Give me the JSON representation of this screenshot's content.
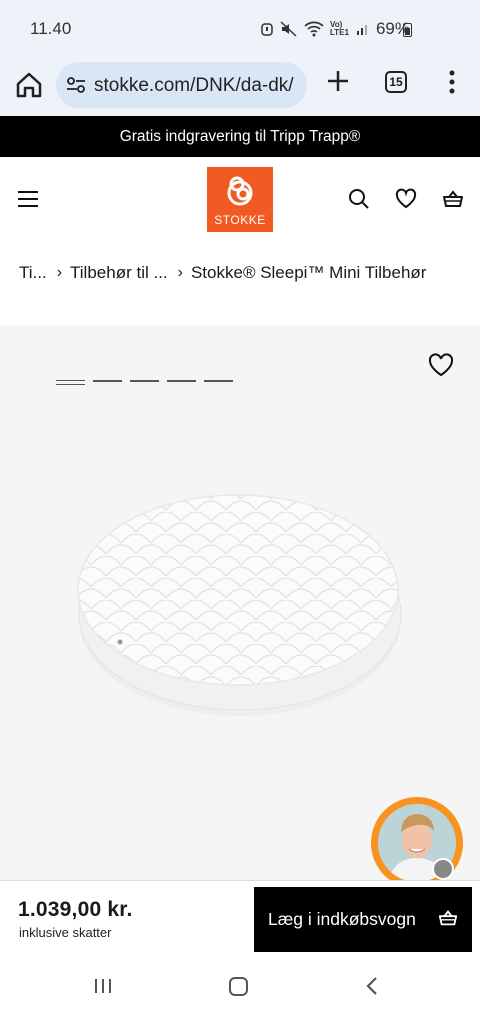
{
  "status_bar": {
    "time": "11.40",
    "network_label": "Vo) LTE1",
    "battery": "69%"
  },
  "browser": {
    "url": "stokke.com/DNK/da-dk/",
    "tab_count": "15"
  },
  "promo_banner": {
    "text": "Gratis indgravering til Tripp Trapp®"
  },
  "header": {
    "logo_text": "STOKKE",
    "icons": [
      "menu-icon",
      "search-icon",
      "heart-icon",
      "basket-icon"
    ]
  },
  "breadcrumb": {
    "items": [
      "Ti...",
      "Tilbehør til ...",
      "Stokke® Sleepi™ Mini Tilbehør"
    ]
  },
  "gallery": {
    "image_count": 5,
    "active_index": 0
  },
  "purchase": {
    "price": "1.039,00 kr.",
    "tax_note": "inklusive skatter",
    "add_to_cart_label": "Læg i indkøbsvogn"
  },
  "colors": {
    "brand_orange": "#f15a22",
    "promo_bg": "#000000",
    "browser_bar_bg": "#eef2f9",
    "url_pill_bg": "#d9e6f6",
    "gallery_bg": "#f5f5f5",
    "chat_ring": "#f7931e"
  }
}
